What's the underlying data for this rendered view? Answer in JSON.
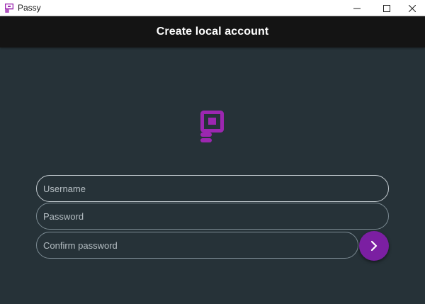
{
  "window": {
    "title": "Passy",
    "controls": [
      "minimize-icon",
      "maximize-icon",
      "close-icon"
    ]
  },
  "appbar": {
    "title": "Create local account"
  },
  "logo": {
    "icon": "passy-logo-icon",
    "color": "#9c27b0"
  },
  "form": {
    "username": {
      "placeholder": "Username",
      "value": ""
    },
    "password": {
      "placeholder": "Password",
      "value": ""
    },
    "confirm_password": {
      "placeholder": "Confirm password",
      "value": ""
    }
  },
  "submit": {
    "icon": "chevron-right-icon",
    "color": "#7b1fa2"
  },
  "colors": {
    "background": "#263238",
    "appbar": "#141414",
    "accent": "#9c27b0"
  }
}
